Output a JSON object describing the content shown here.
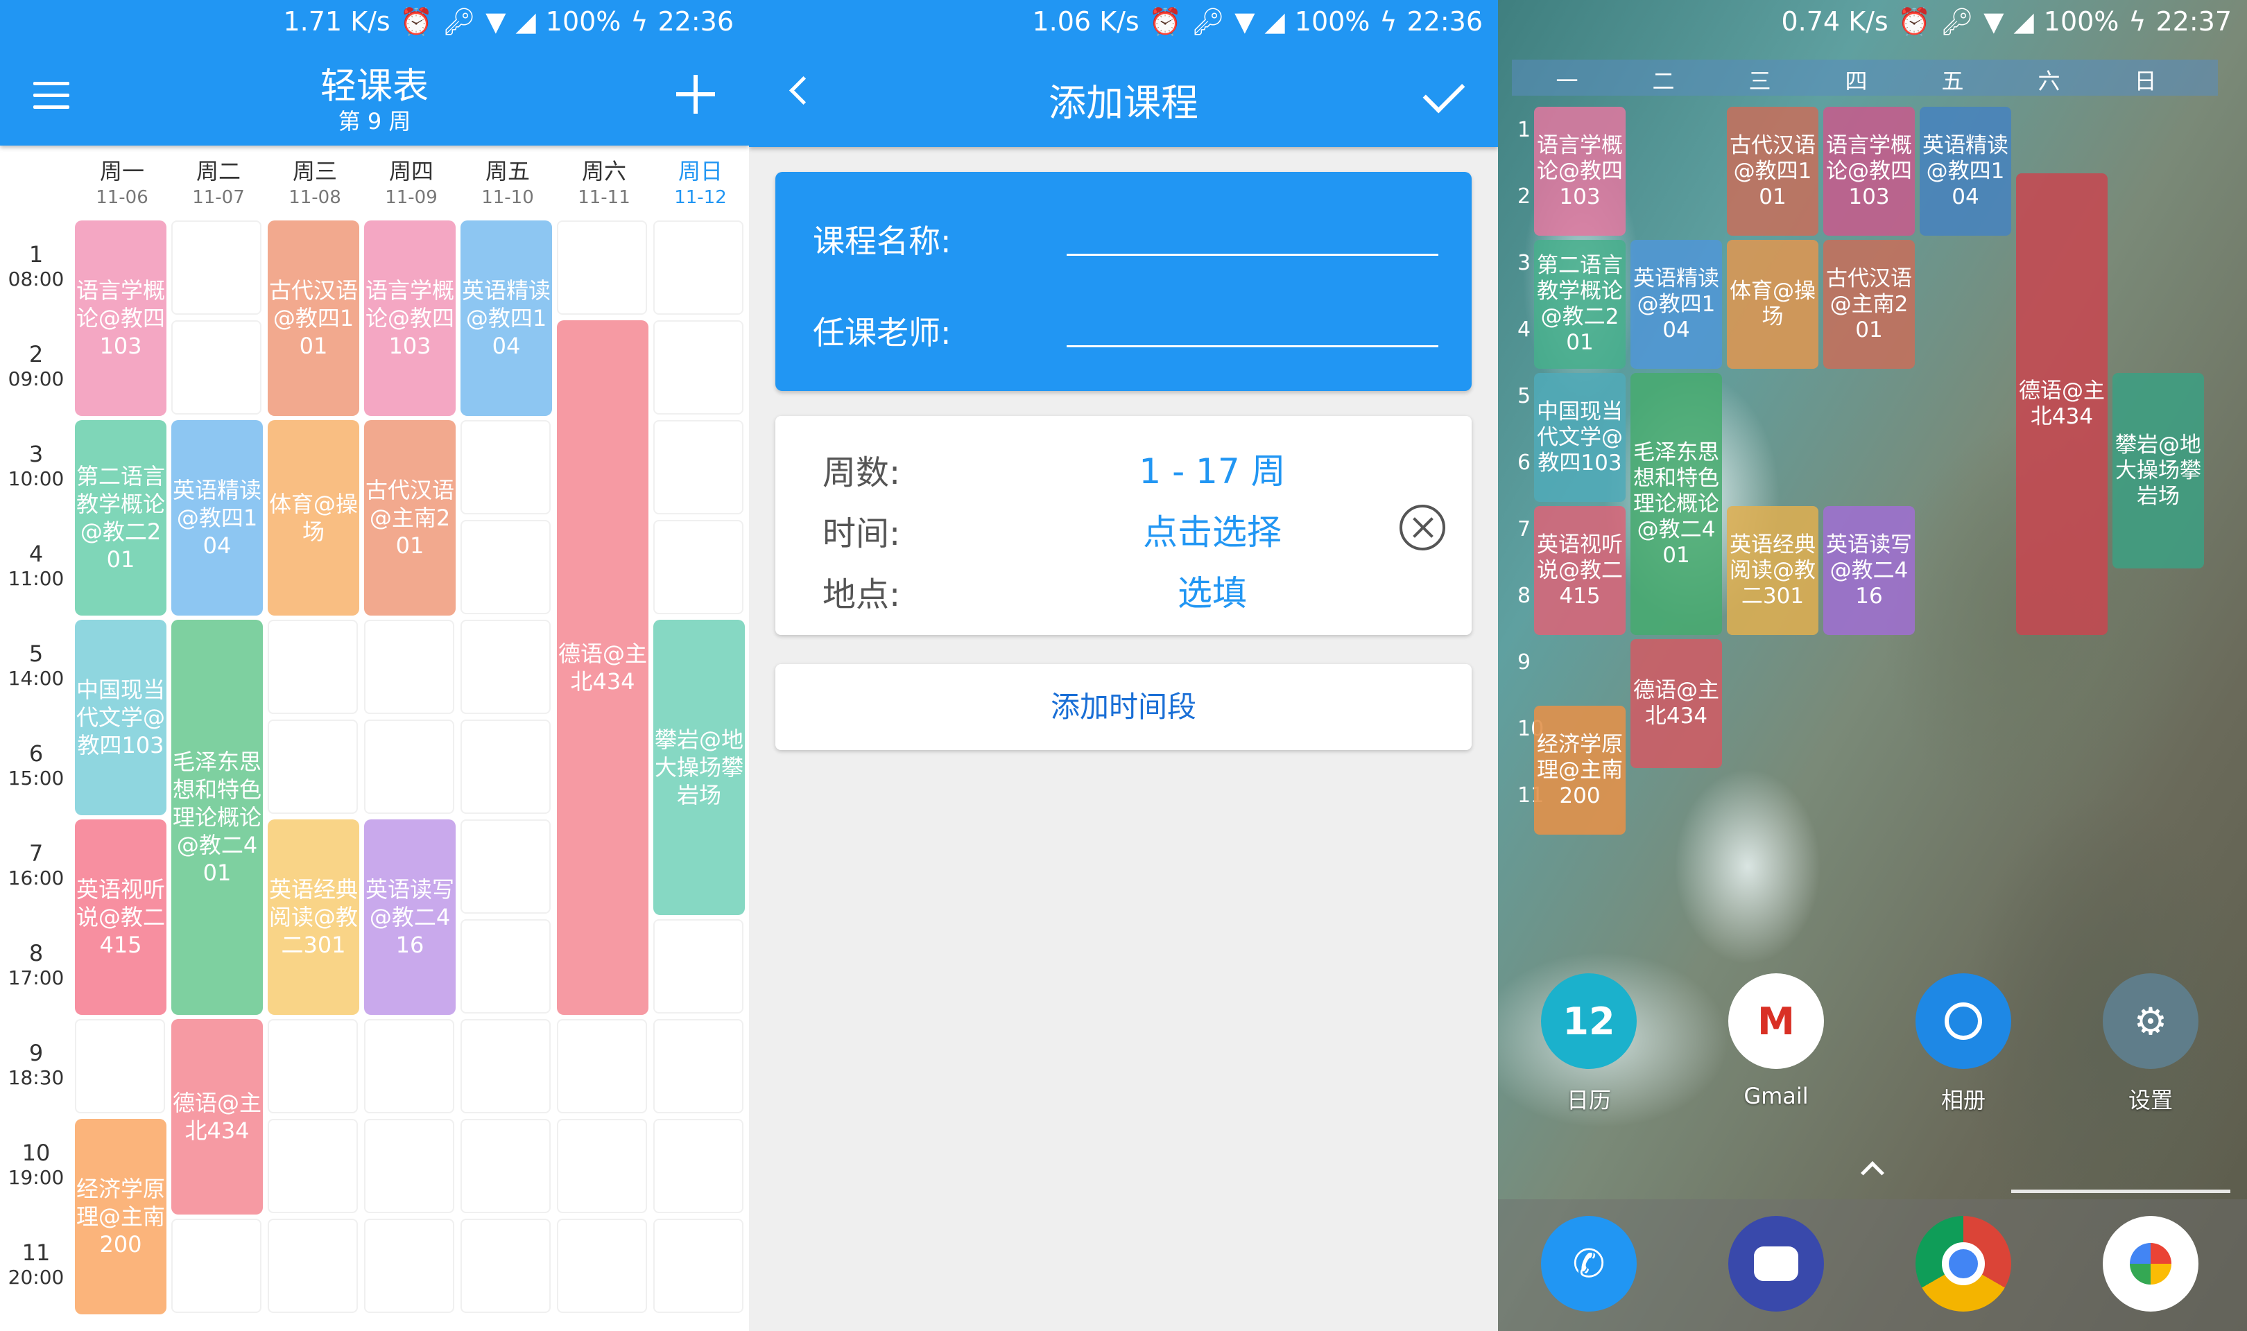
{
  "status_bars": [
    {
      "speed": "1.71 K/s",
      "battery": "100%",
      "time": "22:36"
    },
    {
      "speed": "1.06 K/s",
      "battery": "100%",
      "time": "22:36"
    },
    {
      "speed": "0.74 K/s",
      "battery": "100%",
      "time": "22:37"
    }
  ],
  "schedule": {
    "title": "轻课表",
    "week": "第 9 周",
    "days": [
      {
        "name": "周一",
        "date": "11-06"
      },
      {
        "name": "周二",
        "date": "11-07"
      },
      {
        "name": "周三",
        "date": "11-08"
      },
      {
        "name": "周四",
        "date": "11-09"
      },
      {
        "name": "周五",
        "date": "11-10"
      },
      {
        "name": "周六",
        "date": "11-11"
      },
      {
        "name": "周日",
        "date": "11-12"
      }
    ],
    "periods": [
      {
        "n": "1",
        "t": "08:00"
      },
      {
        "n": "2",
        "t": "09:00"
      },
      {
        "n": "3",
        "t": "10:00"
      },
      {
        "n": "4",
        "t": "11:00"
      },
      {
        "n": "5",
        "t": "14:00"
      },
      {
        "n": "6",
        "t": "15:00"
      },
      {
        "n": "7",
        "t": "16:00"
      },
      {
        "n": "8",
        "t": "17:00"
      },
      {
        "n": "9",
        "t": "18:30"
      },
      {
        "n": "10",
        "t": "19:00"
      },
      {
        "n": "11",
        "t": "20:00"
      }
    ],
    "courses": [
      {
        "day": 0,
        "start": 0,
        "span": 2,
        "text": "语言学概论@教四103",
        "color": "#f4a7c3"
      },
      {
        "day": 0,
        "start": 2,
        "span": 2,
        "text": "第二语言教学概论@教二201",
        "color": "#7fd6b8"
      },
      {
        "day": 0,
        "start": 4,
        "span": 2,
        "text": "中国现当代文学@教四103",
        "color": "#8fd6df"
      },
      {
        "day": 0,
        "start": 6,
        "span": 2,
        "text": "英语视听说@教二415",
        "color": "#f78fa0"
      },
      {
        "day": 0,
        "start": 9,
        "span": 2,
        "text": "经济学原理@主南200",
        "color": "#fbb47b"
      },
      {
        "day": 1,
        "start": 2,
        "span": 2,
        "text": "英语精读@教四104",
        "color": "#8dc6f2"
      },
      {
        "day": 1,
        "start": 4,
        "span": 4,
        "text": "毛泽东思想和特色理论概论@教二401",
        "color": "#7ed0a0"
      },
      {
        "day": 1,
        "start": 8,
        "span": 2,
        "text": "德语@主北434",
        "color": "#f69aa3"
      },
      {
        "day": 2,
        "start": 0,
        "span": 2,
        "text": "古代汉语@教四101",
        "color": "#f2a98e"
      },
      {
        "day": 2,
        "start": 2,
        "span": 2,
        "text": "体育@操场",
        "color": "#f9be82"
      },
      {
        "day": 2,
        "start": 6,
        "span": 2,
        "text": "英语经典阅读@教二301",
        "color": "#f9d487"
      },
      {
        "day": 3,
        "start": 0,
        "span": 2,
        "text": "语言学概论@教四103",
        "color": "#f4a7c3"
      },
      {
        "day": 3,
        "start": 2,
        "span": 2,
        "text": "古代汉语@主南201",
        "color": "#f2a98e"
      },
      {
        "day": 3,
        "start": 6,
        "span": 2,
        "text": "英语读写@教二416",
        "color": "#c9a9ec"
      },
      {
        "day": 4,
        "start": 0,
        "span": 2,
        "text": "英语精读@教四104",
        "color": "#8dc6f2"
      },
      {
        "day": 5,
        "start": 1,
        "span": 7,
        "text": "德语@主北434",
        "color": "#f69aa3"
      },
      {
        "day": 6,
        "start": 4,
        "span": 3,
        "text": "攀岩@地大操场攀岩场",
        "color": "#86d8c3"
      }
    ]
  },
  "add_course": {
    "title": "添加课程",
    "name_label": "课程名称:",
    "teacher_label": "任课老师:",
    "weeks_label": "周数:",
    "weeks_value": "1 - 17 周",
    "time_label": "时间:",
    "time_value": "点击选择",
    "place_label": "地点:",
    "place_value": "选填",
    "add_time_button": "添加时间段"
  },
  "widget": {
    "days": [
      "一",
      "二",
      "三",
      "四",
      "五",
      "六",
      "日"
    ],
    "periods": [
      "1",
      "2",
      "3",
      "4",
      "5",
      "6",
      "7",
      "8",
      "9",
      "10",
      "11"
    ],
    "courses": [
      {
        "day": 0,
        "start": 0,
        "span": 2,
        "text": "语言学概论@教四103",
        "color": "rgba(226,120,160,.85)"
      },
      {
        "day": 0,
        "start": 2,
        "span": 2,
        "text": "第二语言教学概论@教二201",
        "color": "rgba(70,175,140,.85)"
      },
      {
        "day": 0,
        "start": 4,
        "span": 2,
        "text": "中国现当代文学@教四103",
        "color": "rgba(80,170,185,.85)"
      },
      {
        "day": 0,
        "start": 6,
        "span": 2,
        "text": "英语视听说@教二415",
        "color": "rgba(220,100,120,.85)"
      },
      {
        "day": 0,
        "start": 9,
        "span": 2,
        "text": "经济学原理@主南200",
        "color": "rgba(225,145,75,.9)"
      },
      {
        "day": 1,
        "start": 2,
        "span": 2,
        "text": "英语精读@教四104",
        "color": "rgba(80,150,215,.85)"
      },
      {
        "day": 1,
        "start": 4,
        "span": 4,
        "text": "毛泽东思想和特色理论概论@教二401",
        "color": "rgba(70,170,110,.85)"
      },
      {
        "day": 1,
        "start": 8,
        "span": 2,
        "text": "德语@主北434",
        "color": "rgba(210,90,100,.85)"
      },
      {
        "day": 2,
        "start": 0,
        "span": 2,
        "text": "古代汉语@教四101",
        "color": "rgba(200,110,90,.85)"
      },
      {
        "day": 2,
        "start": 2,
        "span": 2,
        "text": "体育@操场",
        "color": "rgba(225,150,80,.85)"
      },
      {
        "day": 2,
        "start": 6,
        "span": 2,
        "text": "英语经典阅读@教二301",
        "color": "rgba(225,175,80,.85)"
      },
      {
        "day": 3,
        "start": 0,
        "span": 2,
        "text": "语言学概论@教四103",
        "color": "rgba(200,90,140,.85)"
      },
      {
        "day": 3,
        "start": 2,
        "span": 2,
        "text": "古代汉语@主南201",
        "color": "rgba(200,110,90,.85)"
      },
      {
        "day": 3,
        "start": 6,
        "span": 2,
        "text": "英语读写@教二416",
        "color": "rgba(160,110,210,.85)"
      },
      {
        "day": 4,
        "start": 0,
        "span": 2,
        "text": "英语精读@教四104",
        "color": "rgba(70,130,190,.85)"
      },
      {
        "day": 5,
        "start": 1,
        "span": 7,
        "text": "德语@主北434",
        "color": "rgba(200,70,80,.85)"
      },
      {
        "day": 6,
        "start": 4,
        "span": 3,
        "text": "攀岩@地大操场攀岩场",
        "color": "rgba(60,160,130,.85)"
      }
    ]
  },
  "home": {
    "apps": [
      {
        "label": "日历",
        "icon": "calendar-icon",
        "glyph": "12",
        "color": "#1BB1CC"
      },
      {
        "label": "Gmail",
        "icon": "gmail-icon",
        "glyph": "M",
        "color": "#ffffff"
      },
      {
        "label": "相册",
        "icon": "photos-icon",
        "glyph": "",
        "color": "#1E88E5"
      },
      {
        "label": "设置",
        "icon": "settings-icon",
        "glyph": "⚙",
        "color": "#5F7D8A"
      }
    ],
    "dock": [
      {
        "icon": "phone-icon",
        "color": "#2196F3"
      },
      {
        "icon": "messages-icon",
        "color": "#3949AB"
      },
      {
        "icon": "chrome-icon",
        "color": "#ffffff"
      },
      {
        "icon": "camera-icon",
        "color": "#ffffff"
      }
    ]
  }
}
